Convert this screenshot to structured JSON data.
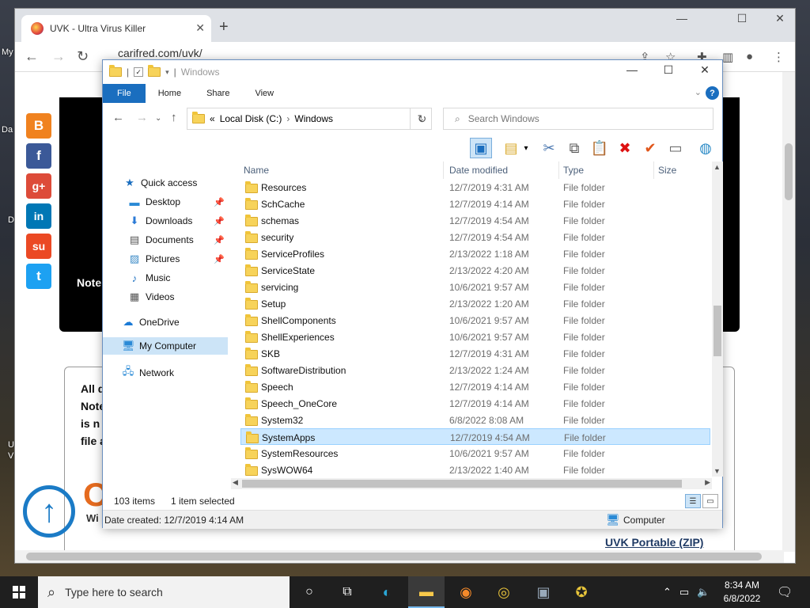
{
  "desktop": {
    "fragments": [
      "My",
      "Da",
      "D",
      "U",
      "V"
    ]
  },
  "browser": {
    "tab_title": "UVK - Ultra Virus Killer",
    "url": "carifred.com/uvk/",
    "page": {
      "note_label": "Note",
      "box_lines": [
        "All d",
        "Note",
        "is n",
        "file a"
      ],
      "win_fragment": "Wi",
      "portable_link": "UVK Portable (ZIP)"
    }
  },
  "explorer": {
    "title": "Windows",
    "ribbon_tabs": [
      "File",
      "Home",
      "Share",
      "View"
    ],
    "address": {
      "root": "Local Disk (C:)",
      "current": "Windows"
    },
    "search_placeholder": "Search Windows",
    "nav": {
      "quick_access": "Quick access",
      "desktop": "Desktop",
      "downloads": "Downloads",
      "documents": "Documents",
      "pictures": "Pictures",
      "music": "Music",
      "videos": "Videos",
      "onedrive": "OneDrive",
      "my_computer": "My Computer",
      "network": "Network"
    },
    "columns": {
      "name": "Name",
      "date": "Date modified",
      "type": "Type",
      "size": "Size"
    },
    "files": [
      {
        "name": "Resources",
        "date": "12/7/2019 4:31 AM",
        "type": "File folder"
      },
      {
        "name": "SchCache",
        "date": "12/7/2019 4:14 AM",
        "type": "File folder"
      },
      {
        "name": "schemas",
        "date": "12/7/2019 4:54 AM",
        "type": "File folder"
      },
      {
        "name": "security",
        "date": "12/7/2019 4:54 AM",
        "type": "File folder"
      },
      {
        "name": "ServiceProfiles",
        "date": "2/13/2022 1:18 AM",
        "type": "File folder"
      },
      {
        "name": "ServiceState",
        "date": "2/13/2022 4:20 AM",
        "type": "File folder"
      },
      {
        "name": "servicing",
        "date": "10/6/2021 9:57 AM",
        "type": "File folder"
      },
      {
        "name": "Setup",
        "date": "2/13/2022 1:20 AM",
        "type": "File folder"
      },
      {
        "name": "ShellComponents",
        "date": "10/6/2021 9:57 AM",
        "type": "File folder"
      },
      {
        "name": "ShellExperiences",
        "date": "10/6/2021 9:57 AM",
        "type": "File folder"
      },
      {
        "name": "SKB",
        "date": "12/7/2019 4:31 AM",
        "type": "File folder"
      },
      {
        "name": "SoftwareDistribution",
        "date": "2/13/2022 1:24 AM",
        "type": "File folder"
      },
      {
        "name": "Speech",
        "date": "12/7/2019 4:14 AM",
        "type": "File folder"
      },
      {
        "name": "Speech_OneCore",
        "date": "12/7/2019 4:14 AM",
        "type": "File folder"
      },
      {
        "name": "System32",
        "date": "6/8/2022 8:08 AM",
        "type": "File folder"
      },
      {
        "name": "SystemApps",
        "date": "12/7/2019 4:54 AM",
        "type": "File folder"
      },
      {
        "name": "SystemResources",
        "date": "10/6/2021 9:57 AM",
        "type": "File folder"
      },
      {
        "name": "SysWOW64",
        "date": "2/13/2022 1:40 AM",
        "type": "File folder"
      }
    ],
    "selected_index": 15,
    "status": {
      "items": "103 items",
      "selected": "1 item selected",
      "date_created": "Date created: 12/7/2019 4:14 AM",
      "location": "Computer"
    }
  },
  "taskbar": {
    "search_placeholder": "Type here to search",
    "time": "8:34 AM",
    "date": "6/8/2022"
  },
  "colors": {
    "accent": "#1a6ebf",
    "selection": "#cce8ff",
    "taskbar": "#1f1f1f"
  }
}
